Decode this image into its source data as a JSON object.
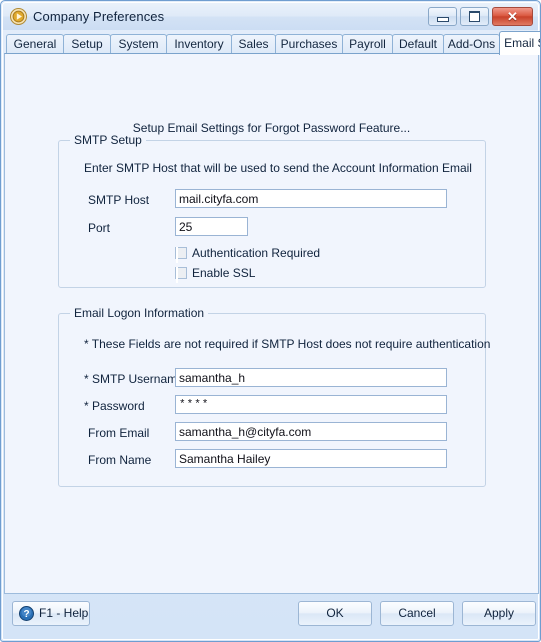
{
  "window": {
    "title": "Company Preferences",
    "icon": "app-play-circle-icon",
    "controls": {
      "minimize": "minimize-icon",
      "maximize": "maximize-icon",
      "close": "✕"
    }
  },
  "tabs": [
    {
      "label": "General",
      "active": false
    },
    {
      "label": "Setup",
      "active": false
    },
    {
      "label": "System",
      "active": false
    },
    {
      "label": "Inventory",
      "active": false
    },
    {
      "label": "Sales",
      "active": false
    },
    {
      "label": "Purchases",
      "active": false
    },
    {
      "label": "Payroll",
      "active": false
    },
    {
      "label": "Default",
      "active": false
    },
    {
      "label": "Add-Ons",
      "active": false
    },
    {
      "label": "Email Setup",
      "active": true
    }
  ],
  "main": {
    "heading": "Setup Email Settings for Forgot Password Feature...",
    "smtp_group": {
      "title": "SMTP Setup",
      "note": "Enter SMTP Host that will be used to send the Account Information Email",
      "fields": [
        {
          "label": "SMTP Host",
          "value": "mail.cityfa.com",
          "placeholder": ""
        },
        {
          "label": "Port",
          "value": "25",
          "placeholder": ""
        }
      ],
      "checkboxes": [
        {
          "label": "Authentication Required",
          "checked": false
        },
        {
          "label": "Enable SSL",
          "checked": false
        }
      ]
    },
    "logon_group": {
      "title": "Email Logon Information",
      "note": "* These Fields are not required if SMTP Host does not require authentication",
      "fields": [
        {
          "label": "* SMTP Username",
          "value": "samantha_h",
          "placeholder": ""
        },
        {
          "label": "* Password",
          "value": "****",
          "placeholder": ""
        },
        {
          "label": "From Email",
          "value": "samantha_h@cityfa.com",
          "placeholder": ""
        },
        {
          "label": "From Name",
          "value": "Samantha Hailey",
          "placeholder": ""
        }
      ]
    }
  },
  "footer": {
    "help_label": "F1 - Help",
    "help_icon": "question-mark-circle-icon",
    "ok_label": "OK",
    "cancel_label": "Cancel",
    "apply_label": "Apply"
  },
  "colors": {
    "window_border": "#6f9dd0",
    "content_bg": "#f1f5fd",
    "close_button": "#c9422a",
    "help_icon_blue": "#2a6fb5",
    "group_border": "#c3d3e6",
    "input_border": "#9ab4d4"
  }
}
